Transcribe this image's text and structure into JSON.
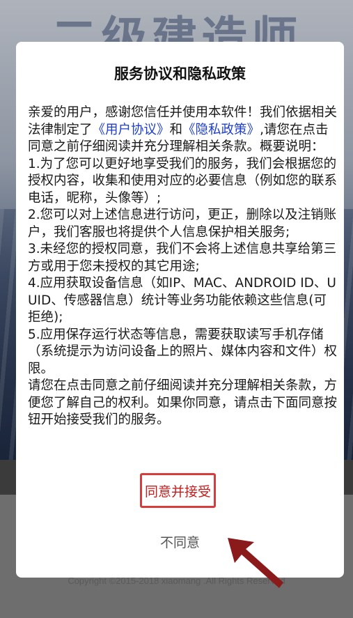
{
  "background": {
    "app_title": "二级建造师",
    "copyright": "Copyright ©2015-2018 xiaomang .All Rights Reserved"
  },
  "dialog": {
    "title": "服务协议和隐私政策",
    "intro_prefix": "亲爱的用户，感谢您信任并使用本软件！我们依据相关法律制定了",
    "link_user_agreement": "《用户协议》",
    "and": "和",
    "link_privacy_policy": "《隐私政策》",
    "intro_suffix": ",请您在点击同意之前仔细阅读并充分理解相关条款。概要说明：",
    "item1": "1.为了您可以更好地享受我们的服务，我们会根据您的授权内容，收集和使用对应的必要信息（例如您的联系电话，昵称，头像等）;",
    "item2": "2.您可以对上述信息进行访问，更正，删除以及注销账户，我们客服也将提供个人信息保护相关服务;",
    "item3": "3.未经您的授权同意，我们不会将上述信息共享给第三方或用于您未授权的其它用途;",
    "item4": "4.应用获取设备信息（如IP、MAC、ANDROID ID、UUID、传感器信息）统计等业务功能依赖这些信息(可拒绝);",
    "item5": "5.应用保存运行状态等信息，需要获取读写手机存储（系统提示为访问设备上的照片、媒体内容和文件）权限。",
    "closing": "请您在点击同意之前仔细阅读并充分理解相关条款，方便您了解自己的权利。如果你同意，请点击下面同意按钮开始接受我们的服务。",
    "agree_label": "同意并接受",
    "disagree_label": "不同意"
  },
  "colors": {
    "link": "#1e3fd0",
    "agree_border": "#d83b3b",
    "agree_text": "#c21f1f",
    "arrow": "#8b1a1a"
  },
  "icons": {
    "annotation_arrow": "arrow-pointing-up-left"
  }
}
